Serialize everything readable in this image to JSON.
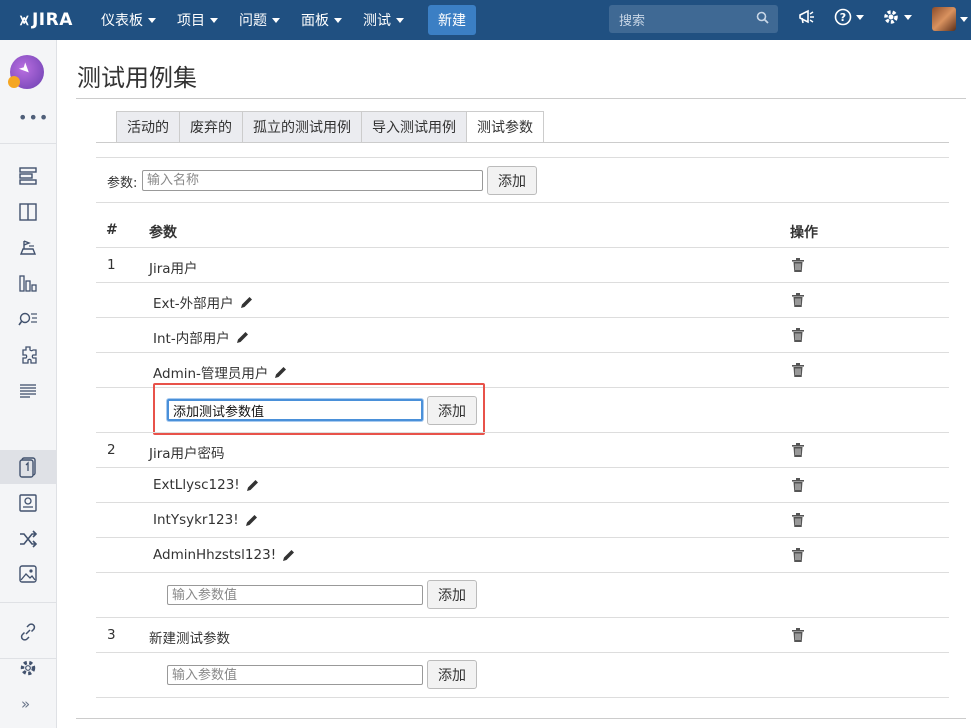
{
  "topnav": {
    "logo_text": "JIRA",
    "menus": [
      "仪表板",
      "项目",
      "问题",
      "面板",
      "测试"
    ],
    "create_label": "新建",
    "search_placeholder": "搜索",
    "help_glyph": "?"
  },
  "sidebar": {
    "items": [
      "board-icon",
      "backlog-icon",
      "releases-icon",
      "reports-icon",
      "search-issues-icon",
      "components-icon",
      "list-icon",
      "test-cases-icon",
      "test-runs-icon",
      "shuffle-icon",
      "gallery-icon",
      "link-icon",
      "settings-icon"
    ],
    "collapse_glyph": "»"
  },
  "page": {
    "title": "测试用例集",
    "tabs": [
      {
        "label": "活动的",
        "active": false
      },
      {
        "label": "废弃的",
        "active": false
      },
      {
        "label": "孤立的测试用例",
        "active": false
      },
      {
        "label": "导入测试用例",
        "active": false
      },
      {
        "label": "测试参数",
        "active": true
      }
    ],
    "param_label": "参数:",
    "name_placeholder": "输入名称",
    "add_label": "添加"
  },
  "table": {
    "headers": {
      "num": "#",
      "param": "参数",
      "actions": "操作"
    },
    "groups": [
      {
        "num": "1",
        "name": "Jira用户",
        "values": [
          "Ext-外部用户",
          "Int-内部用户",
          "Admin-管理员用户"
        ],
        "new_value": "添加测试参数值",
        "value_placeholder": "输入参数值"
      },
      {
        "num": "2",
        "name": "Jira用户密码",
        "values": [
          "ExtLlysc123!",
          "IntYsykr123!",
          "AdminHhzstsl123!"
        ],
        "new_value": "",
        "value_placeholder": "输入参数值"
      },
      {
        "num": "3",
        "name": "新建测试参数",
        "values": [],
        "new_value": "",
        "value_placeholder": "输入参数值"
      }
    ]
  },
  "colors": {
    "nav_bg": "#205081",
    "create_btn": "#3b7fc4",
    "highlight": "#e8524a"
  }
}
